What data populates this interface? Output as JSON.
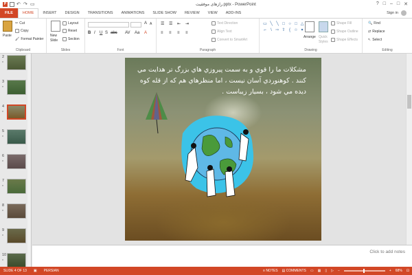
{
  "window": {
    "title": "رازهای موفقیت.pptx - PowerPoint",
    "controls": [
      "?",
      "□",
      "–",
      "□",
      "✕"
    ]
  },
  "tabs": [
    {
      "label": "FILE"
    },
    {
      "label": "HOME"
    },
    {
      "label": "INSERT"
    },
    {
      "label": "DESIGN"
    },
    {
      "label": "TRANSITIONS"
    },
    {
      "label": "ANIMATIONS"
    },
    {
      "label": "SLIDE SHOW"
    },
    {
      "label": "REVIEW"
    },
    {
      "label": "VIEW"
    },
    {
      "label": "ADD-INS"
    }
  ],
  "signin": "Sign in",
  "ribbon": {
    "clipboard": {
      "label": "Clipboard",
      "paste": "Paste",
      "cut": "Cut",
      "copy": "Copy",
      "format_painter": "Format Painter"
    },
    "slides": {
      "label": "Slides",
      "new_slide": "New",
      "new_slide2": "Slide",
      "layout": "Layout",
      "reset": "Reset",
      "section": "Section"
    },
    "font": {
      "label": "Font"
    },
    "paragraph": {
      "label": "Paragraph",
      "text_direction": "Text Direction",
      "align_text": "Align Text",
      "convert": "Convert to SmartArt"
    },
    "drawing": {
      "label": "Drawing",
      "arrange": "Arrange",
      "quick_styles": "Quick",
      "quick_styles2": "Styles",
      "shape_fill": "Shape Fill",
      "shape_outline": "Shape Outline",
      "shape_effects": "Shape Effects"
    },
    "editing": {
      "label": "Editing",
      "find": "Find",
      "replace": "Replace",
      "select": "Select"
    }
  },
  "thumbnails": [
    {
      "num": "2",
      "star": "*"
    },
    {
      "num": "3",
      "star": "*"
    },
    {
      "num": "4",
      "star": "*"
    },
    {
      "num": "5",
      "star": "*"
    },
    {
      "num": "6",
      "star": "*"
    },
    {
      "num": "7",
      "star": "*"
    },
    {
      "num": "8",
      "star": "*"
    },
    {
      "num": "9",
      "star": "*"
    },
    {
      "num": "10",
      "star": "*"
    }
  ],
  "slide": {
    "text": "مشکلات ما را قوي و به سمت پيروزي هاي بزرگ تر هدايت   مي کنند . کوهنوردي آسان نيست ، اما منظرهاي هم که از قله کوه ديده مي شود ، بسيار زيباست ."
  },
  "notes_placeholder": "Click to add notes",
  "status": {
    "slide_of": "SLIDE 4 OF 13",
    "language": "PERSIAN",
    "notes": "NOTES",
    "comments": "COMMENTS",
    "zoom": "68%"
  },
  "colors": {
    "accent": "#d24726",
    "selected_thumb_border": "#d24726"
  }
}
